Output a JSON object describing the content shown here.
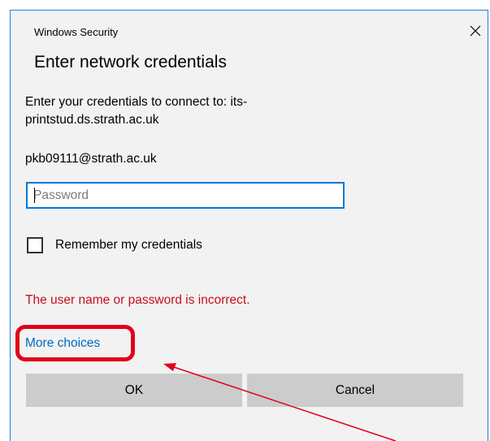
{
  "window": {
    "title": "Windows Security",
    "close_glyph": "✕"
  },
  "dialog": {
    "heading": "Enter network credentials",
    "prompt": "Enter your credentials to connect to: its-printstud.ds.strath.ac.uk",
    "username": "pkb09111@strath.ac.uk",
    "password": {
      "value": "",
      "placeholder": "Password"
    },
    "remember": {
      "label": "Remember my credentials",
      "checked": false
    },
    "error_message": "The user name or password is incorrect.",
    "more_choices_label": "More choices",
    "buttons": {
      "ok": "OK",
      "cancel": "Cancel"
    }
  },
  "colors": {
    "dialog_border": "#1883d7",
    "dialog_bg": "#f2f2f2",
    "error": "#c50f1f",
    "link": "#0067c0",
    "input_focus": "#0078d7",
    "annotation": "#e0001a",
    "button_bg": "#cccccc"
  }
}
